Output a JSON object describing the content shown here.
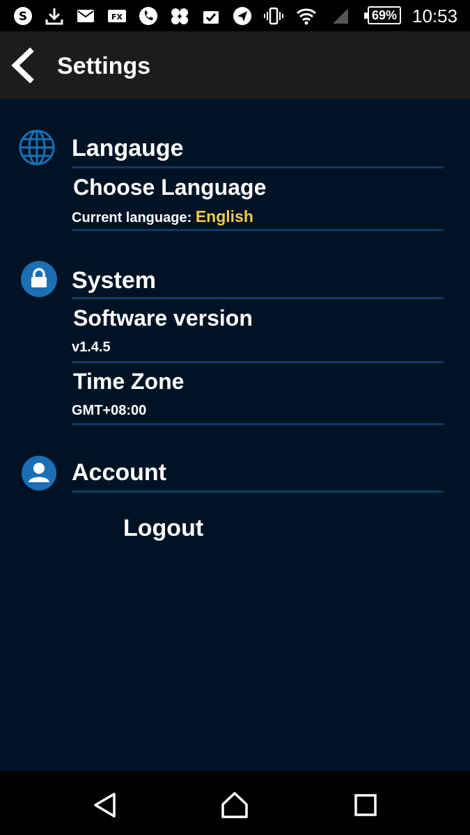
{
  "status_bar": {
    "icons": [
      "skype-icon",
      "download-icon",
      "mail-icon",
      "fx-icon",
      "phone-icon",
      "app-icon",
      "checklist-icon",
      "send-icon",
      "vibrate-icon",
      "wifi-icon",
      "signal-icon"
    ],
    "battery": "69%",
    "time": "10:53"
  },
  "appbar": {
    "title": "Settings"
  },
  "sections": {
    "language": {
      "title": "Langauge",
      "choose_label": "Choose Language",
      "current_label": "Current language:",
      "current_value": "English"
    },
    "system": {
      "title": "System",
      "software_label": "Software version",
      "software_value": "v1.4.5",
      "timezone_label": "Time Zone",
      "timezone_value": "GMT+08:00"
    },
    "account": {
      "title": "Account",
      "logout_label": "Logout"
    }
  },
  "colors": {
    "accent": "#f2c94c",
    "divider": "#0f3a66",
    "background": "#001325",
    "icon_blue": "#1a6fb5"
  }
}
